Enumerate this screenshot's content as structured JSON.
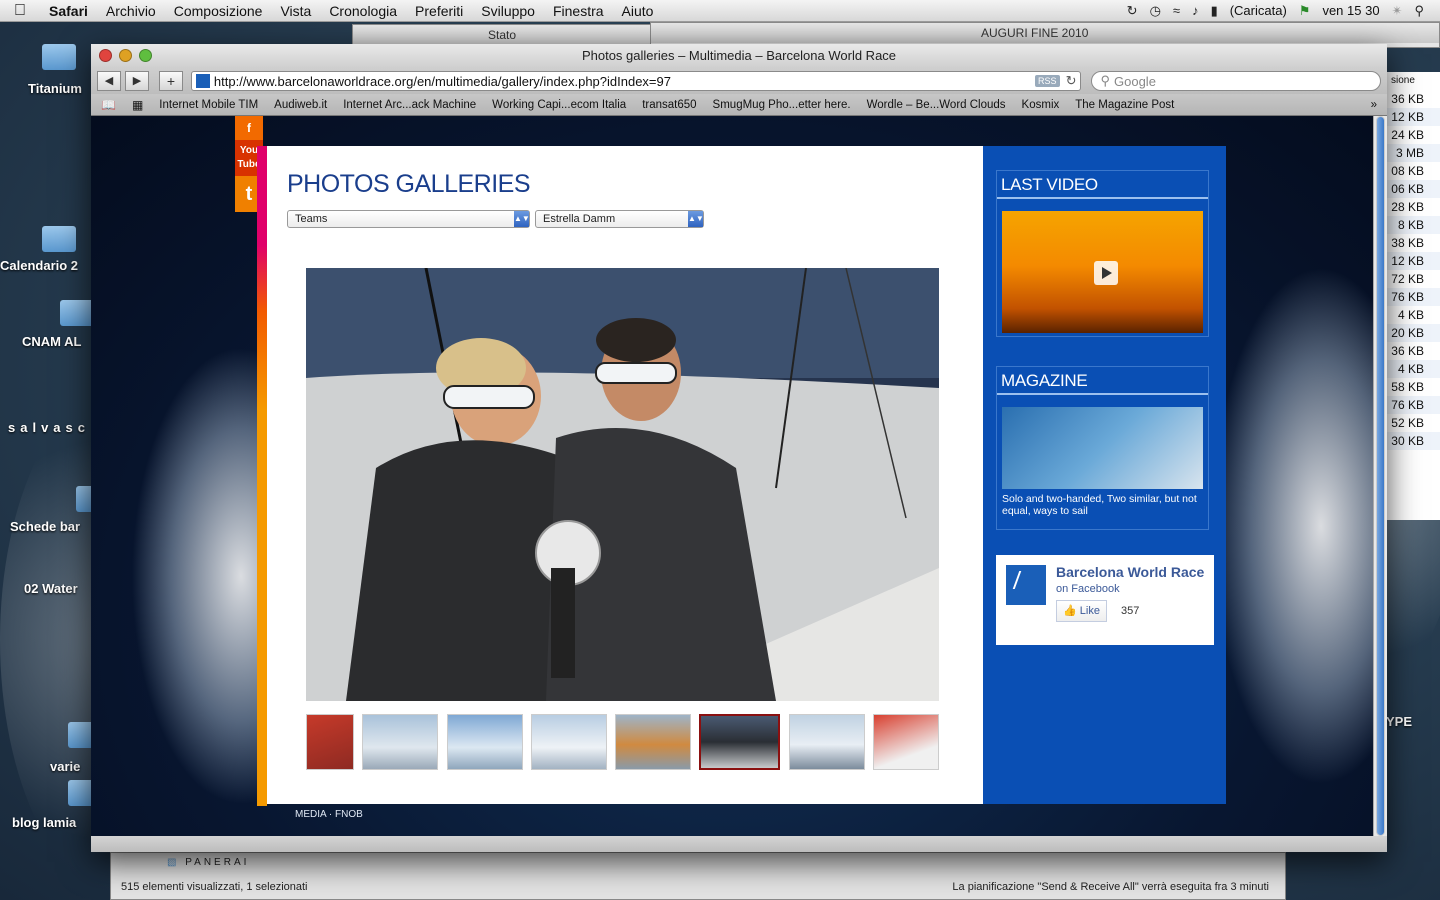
{
  "menubar": {
    "app": "Safari",
    "items": [
      "Archivio",
      "Composizione",
      "Vista",
      "Cronologia",
      "Preferiti",
      "Sviluppo",
      "Finestra",
      "Aiuto"
    ],
    "battery": "(Caricata)",
    "clock": "ven 15 30"
  },
  "desktop": {
    "icons": [
      "Titanium",
      "Calendario 2",
      "CNAM AL",
      "salvasc",
      "Schede bar",
      "02 Water",
      "varie",
      "blog lamia"
    ],
    "right_label": "YPE"
  },
  "background_windows": {
    "stato_title": "Stato",
    "auguri_title": "AUGURI FINE 2010",
    "sizes_header": "sione",
    "sizes": [
      "36 KB",
      "12 KB",
      "24 KB",
      "3 MB",
      "08 KB",
      "06 KB",
      "28 KB",
      "8 KB",
      "38 KB",
      "12 KB",
      "72 KB",
      "76 KB",
      "4 KB",
      "20 KB",
      "36 KB",
      "4 KB",
      "58 KB",
      "76 KB",
      "52 KB",
      "30 KB"
    ]
  },
  "safari": {
    "window_title": "Photos galleries – Multimedia – Barcelona World Race",
    "url": "http://www.barcelonaworldrace.org/en/multimedia/gallery/index.php?idIndex=97",
    "rss_label": "RSS",
    "search_placeholder": "Google",
    "bookmarks": [
      "Internet Mobile TIM",
      "Audiweb.it",
      "Internet Arc...ack Machine",
      "Working Capi...ecom Italia",
      "transat650",
      "SmugMug Pho...etter here.",
      "Wordle – Be...Word Clouds",
      "Kosmix",
      "The Magazine Post"
    ]
  },
  "page": {
    "social": [
      "f",
      "You Tube",
      "t"
    ],
    "title": "PHOTOS GALLERIES",
    "select_category": "Teams",
    "select_team": "Estrella Damm",
    "selected_thumb_index": 5,
    "thumb_count": 8,
    "last_video_title": "LAST VIDEO",
    "magazine_title": "MAGAZINE",
    "magazine_caption": "Solo and two-handed, Two similar, but not equal, ways to sail",
    "fb": {
      "name": "Barcelona World Race",
      "on_fb": "on Facebook",
      "like": "Like",
      "count": "357"
    },
    "footer": "MEDIA · FNOB"
  },
  "finder_bottom": {
    "folder": "PANERAI",
    "status_left": "515 elementi visualizzati, 1 selezionati",
    "status_right": "La pianificazione \"Send & Receive All\" verrà eseguita fra 3 minuti"
  },
  "colors": {
    "accent_blue": "#0a4fb4",
    "title_blue": "#1a3e8c",
    "stripe_orange": "#f59a00",
    "stripe_pink": "#e0006a"
  }
}
